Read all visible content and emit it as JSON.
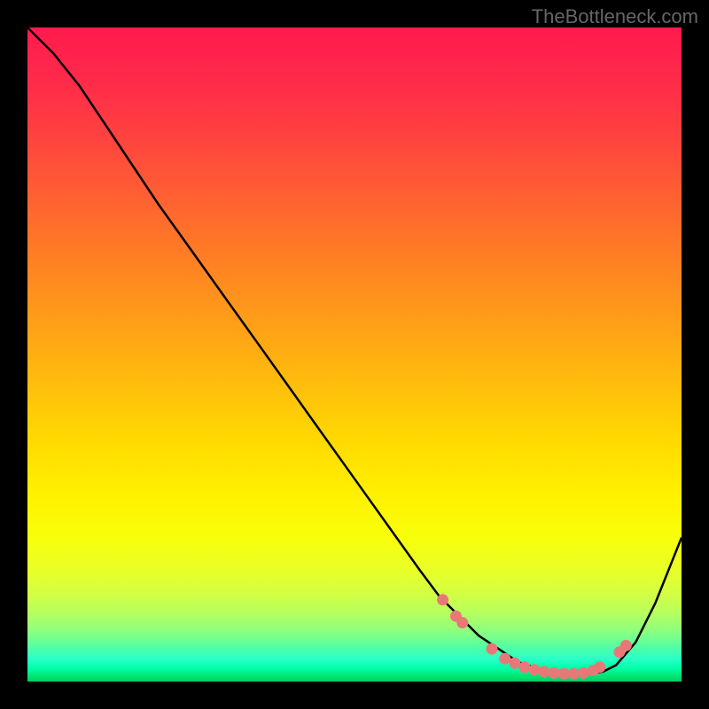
{
  "watermark": "TheBottleneck.com",
  "chart_data": {
    "type": "line",
    "title": "",
    "xlabel": "",
    "ylabel": "",
    "xlim": [
      0,
      100
    ],
    "ylim": [
      0,
      100
    ],
    "series": [
      {
        "name": "bottleneck-curve",
        "x": [
          0,
          4,
          8,
          12,
          16,
          20,
          25,
          30,
          35,
          40,
          45,
          50,
          55,
          60,
          63,
          66,
          69,
          72,
          75,
          78,
          81,
          84,
          86,
          88,
          90,
          93,
          96,
          100
        ],
        "y": [
          100,
          96,
          91,
          85,
          79,
          73,
          66,
          59,
          52,
          45,
          38,
          31,
          24,
          17,
          13,
          10,
          7,
          5,
          3,
          2,
          1.5,
          1.2,
          1.2,
          1.5,
          2.5,
          6,
          12,
          22
        ]
      }
    ],
    "markers": {
      "name": "highlight-dots",
      "color": "#e87878",
      "points": [
        {
          "x": 63.5,
          "y": 12.5
        },
        {
          "x": 65.5,
          "y": 10
        },
        {
          "x": 66.5,
          "y": 9
        },
        {
          "x": 71,
          "y": 5
        },
        {
          "x": 73,
          "y": 3.5
        },
        {
          "x": 74.5,
          "y": 2.8
        },
        {
          "x": 76,
          "y": 2.2
        },
        {
          "x": 77.5,
          "y": 1.8
        },
        {
          "x": 79,
          "y": 1.5
        },
        {
          "x": 80.5,
          "y": 1.3
        },
        {
          "x": 82,
          "y": 1.2
        },
        {
          "x": 83.5,
          "y": 1.2
        },
        {
          "x": 85,
          "y": 1.3
        },
        {
          "x": 86.5,
          "y": 1.7
        },
        {
          "x": 87.5,
          "y": 2.2
        },
        {
          "x": 90.5,
          "y": 4.5
        },
        {
          "x": 91.5,
          "y": 5.5
        }
      ]
    },
    "background_gradient": {
      "top": "#ff1a4d",
      "mid": "#ffea00",
      "bottom": "#00d060"
    }
  }
}
